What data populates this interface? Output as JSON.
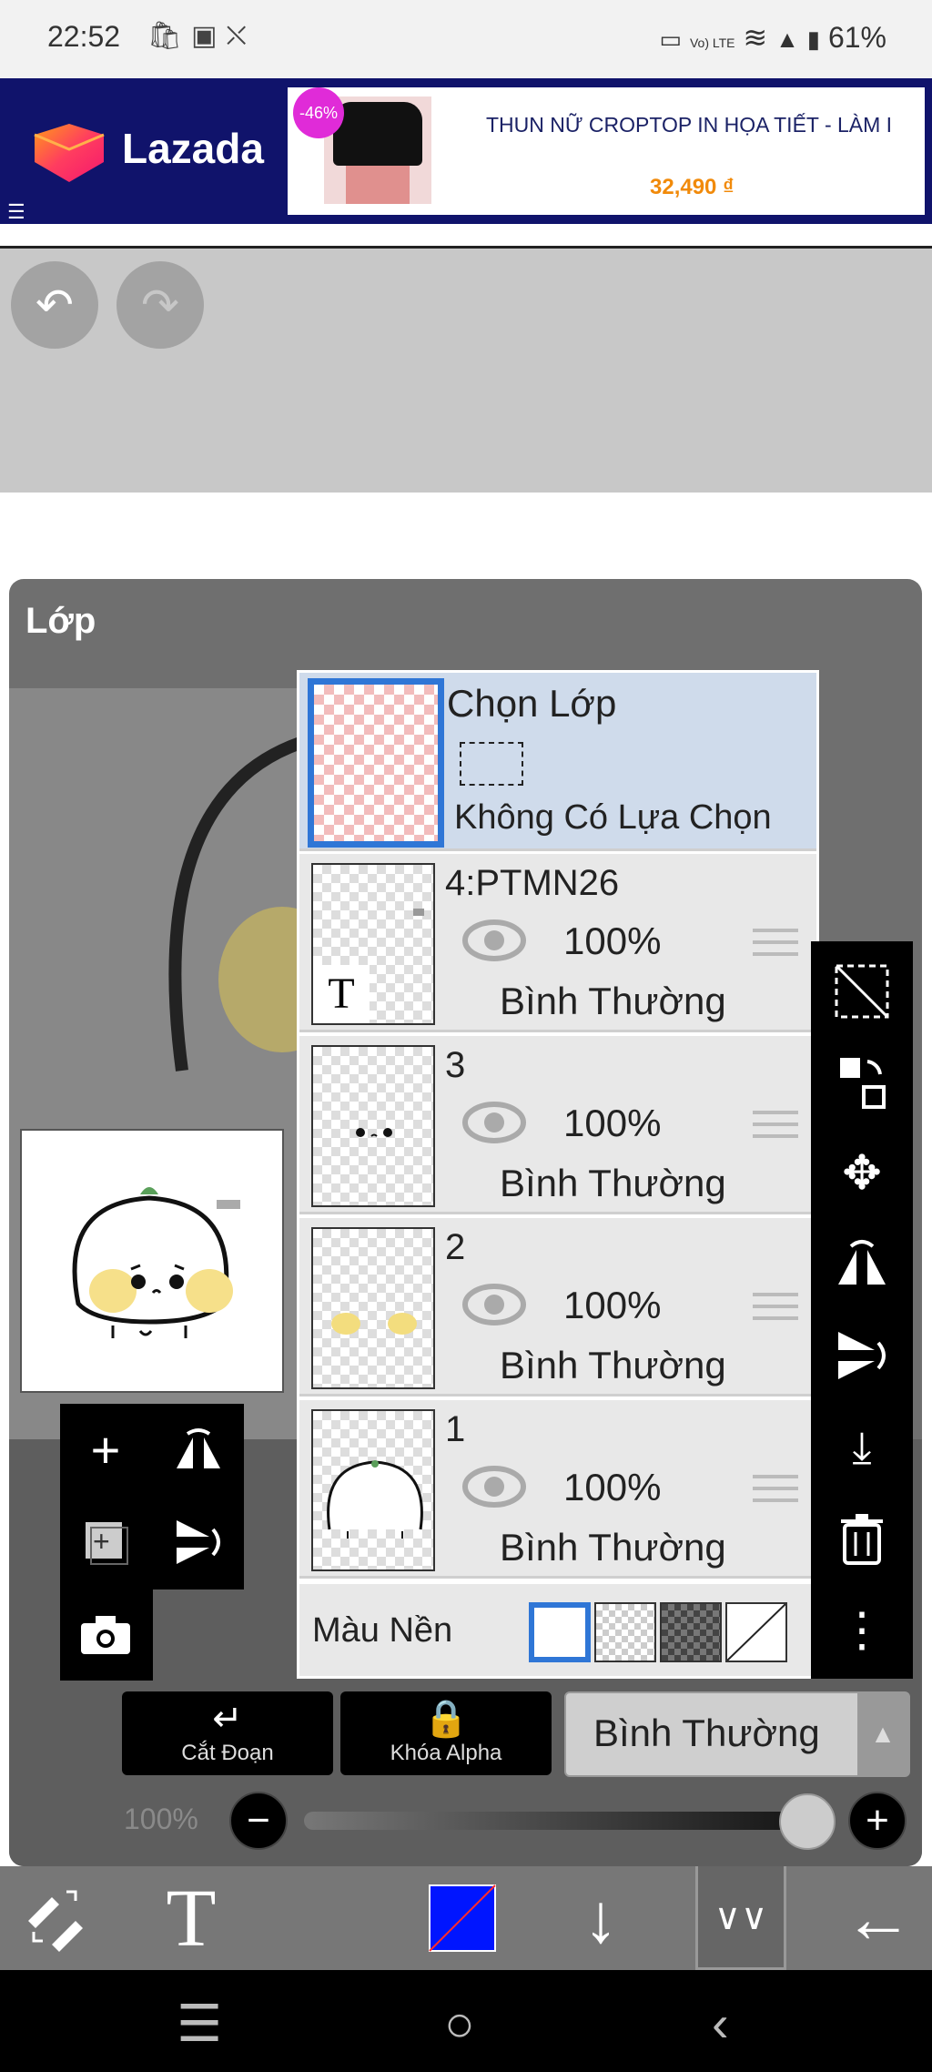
{
  "status_bar": {
    "time": "22:52",
    "lte": "Vo) LTE",
    "battery": "61%"
  },
  "ad": {
    "brand": "Lazada",
    "discount": "-46%",
    "product_title": "THUN NỮ CROPTOP IN HỌA TIẾT - LÀM I",
    "price": "32,490 ₫",
    "colors": {
      "background": "#10136b",
      "price": "#f18a0a"
    }
  },
  "panel": {
    "title": "Lớp",
    "selection_row": {
      "title": "Chọn Lớp",
      "status": "Không Có Lựa Chọn"
    },
    "layers": [
      {
        "name": "4:PTMN26",
        "opacity": "100%",
        "blend": "Bình Thường",
        "thumb_glyph": "T"
      },
      {
        "name": "3",
        "opacity": "100%",
        "blend": "Bình Thường"
      },
      {
        "name": "2",
        "opacity": "100%",
        "blend": "Bình Thường"
      },
      {
        "name": "1",
        "opacity": "100%",
        "blend": "Bình Thường"
      }
    ],
    "background": {
      "label": "Màu Nền",
      "selected": "white"
    },
    "clip_label": "Cắt Đoạn",
    "alpha_lock_label": "Khóa Alpha",
    "blend_mode": "Bình Thường",
    "opacity": {
      "label": "100%",
      "value": 100
    }
  },
  "colors": {
    "selection_blue": "#2f76d6",
    "current_color": "#0015ff"
  }
}
